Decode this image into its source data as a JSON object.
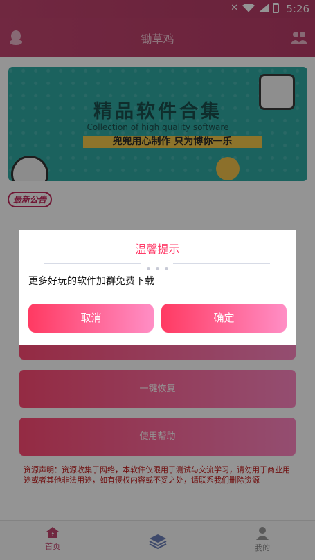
{
  "status_bar": {
    "time": "5:26"
  },
  "header": {
    "title": "锄草鸡"
  },
  "banner": {
    "title": "精品软件合集",
    "subtitle": "Collection of high quality software",
    "slogan": "兜兜用心制作 只为博你一乐"
  },
  "notice_badge": "最新公告",
  "actions": [
    {
      "label": "一键恢复"
    },
    {
      "label": "使用帮助"
    }
  ],
  "disclaimer": "资源声明：资源收集于网络，本软件仅限用于测试与交流学习，请勿用于商业用途或者其他非法用途，如有侵权内容或不妥之处，请联系我们删除资源",
  "bottom_nav": {
    "home_label": "首页",
    "mine_label": "我的"
  },
  "dialog": {
    "title": "温馨提示",
    "message": "更多好玩的软件加群免费下载",
    "cancel_label": "取消",
    "ok_label": "确定"
  },
  "colors": {
    "header": "#c34670",
    "accent": "#ff3d6a",
    "button_start": "#ff4a74",
    "button_end": "#ff86c2",
    "disclaimer": "#c11d1d"
  }
}
